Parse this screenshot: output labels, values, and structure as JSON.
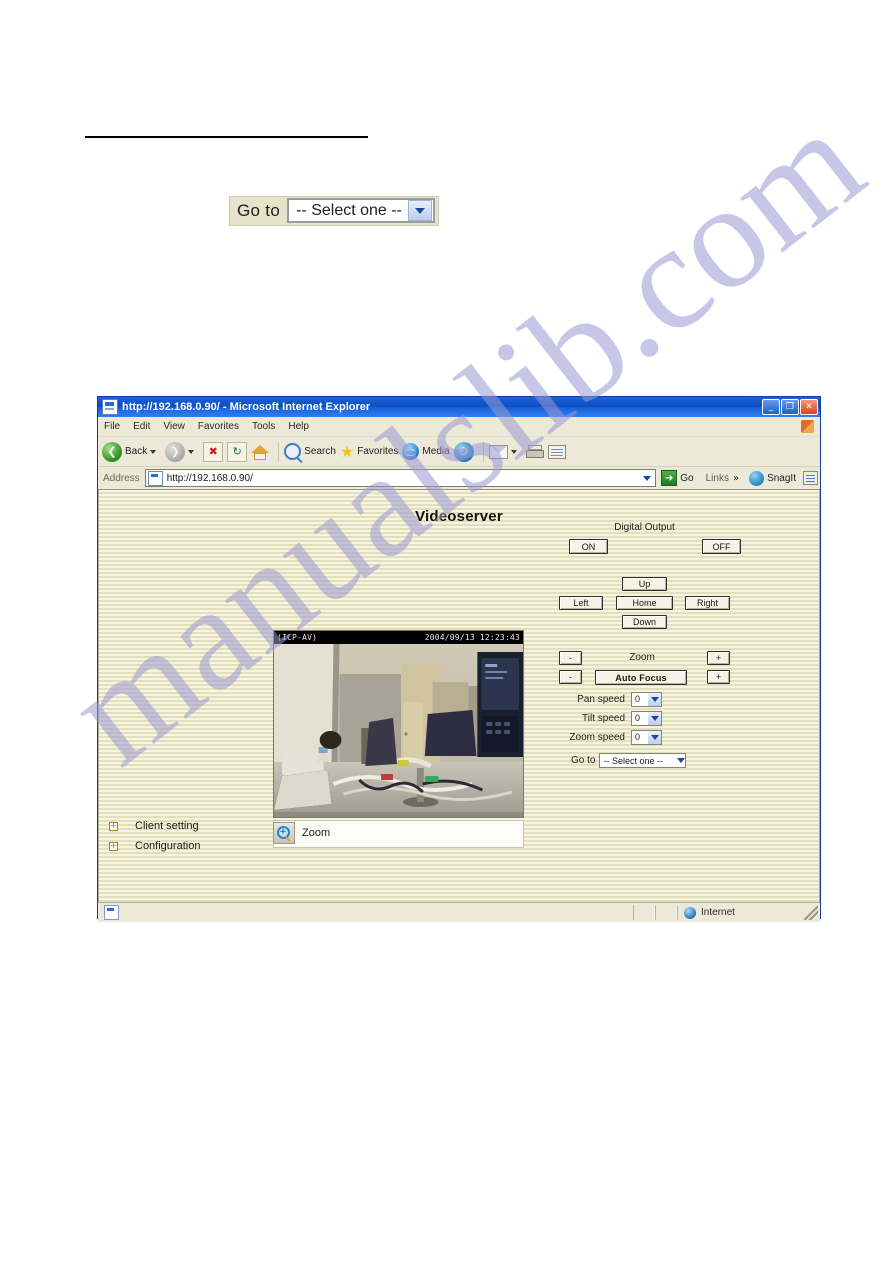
{
  "document": {
    "goto_widget": {
      "label": "Go to",
      "selected": "-- Select one --"
    }
  },
  "browser": {
    "title": "http://192.168.0.90/ - Microsoft Internet Explorer",
    "window_buttons": {
      "minimize": "_",
      "maximize": "❐",
      "close": "✕"
    },
    "menu": [
      "File",
      "Edit",
      "View",
      "Favorites",
      "Tools",
      "Help"
    ],
    "toolbar": {
      "back": "Back",
      "forward": "",
      "stop": "✖",
      "refresh": "↻",
      "home": "",
      "search": "Search",
      "favorites": "Favorites",
      "media": "Media",
      "history": ""
    },
    "address": {
      "label": "Address",
      "value": "http://192.168.0.90/",
      "go": "Go",
      "links": "Links",
      "chevron": "»",
      "snagit": "SnagIt"
    },
    "statusbar": {
      "zone": "Internet"
    }
  },
  "page": {
    "title": "Videoserver",
    "video": {
      "osd_left": "(ICP-AV)",
      "osd_right": "2004/09/13 12:23:43"
    },
    "zoom_link": {
      "label": "Zoom",
      "icon_glyph": "+"
    },
    "sidebar": {
      "items": [
        {
          "label": "Client setting",
          "bullet": "+"
        },
        {
          "label": "Configuration",
          "bullet": "+"
        }
      ]
    },
    "controls": {
      "digital_output": {
        "title": "Digital Output",
        "on": "ON",
        "off": "OFF"
      },
      "ptz": {
        "up": "Up",
        "left": "Left",
        "home": "Home",
        "right": "Right",
        "down": "Down"
      },
      "zoom_row": {
        "minus": "-",
        "label": "Zoom",
        "plus": "+"
      },
      "focus_row": {
        "minus": "-",
        "label": "Auto Focus",
        "plus": "+"
      },
      "speeds": [
        {
          "label": "Pan speed",
          "value": "0"
        },
        {
          "label": "Tilt speed",
          "value": "0"
        },
        {
          "label": "Zoom speed",
          "value": "0"
        }
      ],
      "goto": {
        "label": "Go to",
        "selected": "-- Select one --"
      }
    }
  },
  "watermark": {
    "text": "manualslib.com"
  }
}
